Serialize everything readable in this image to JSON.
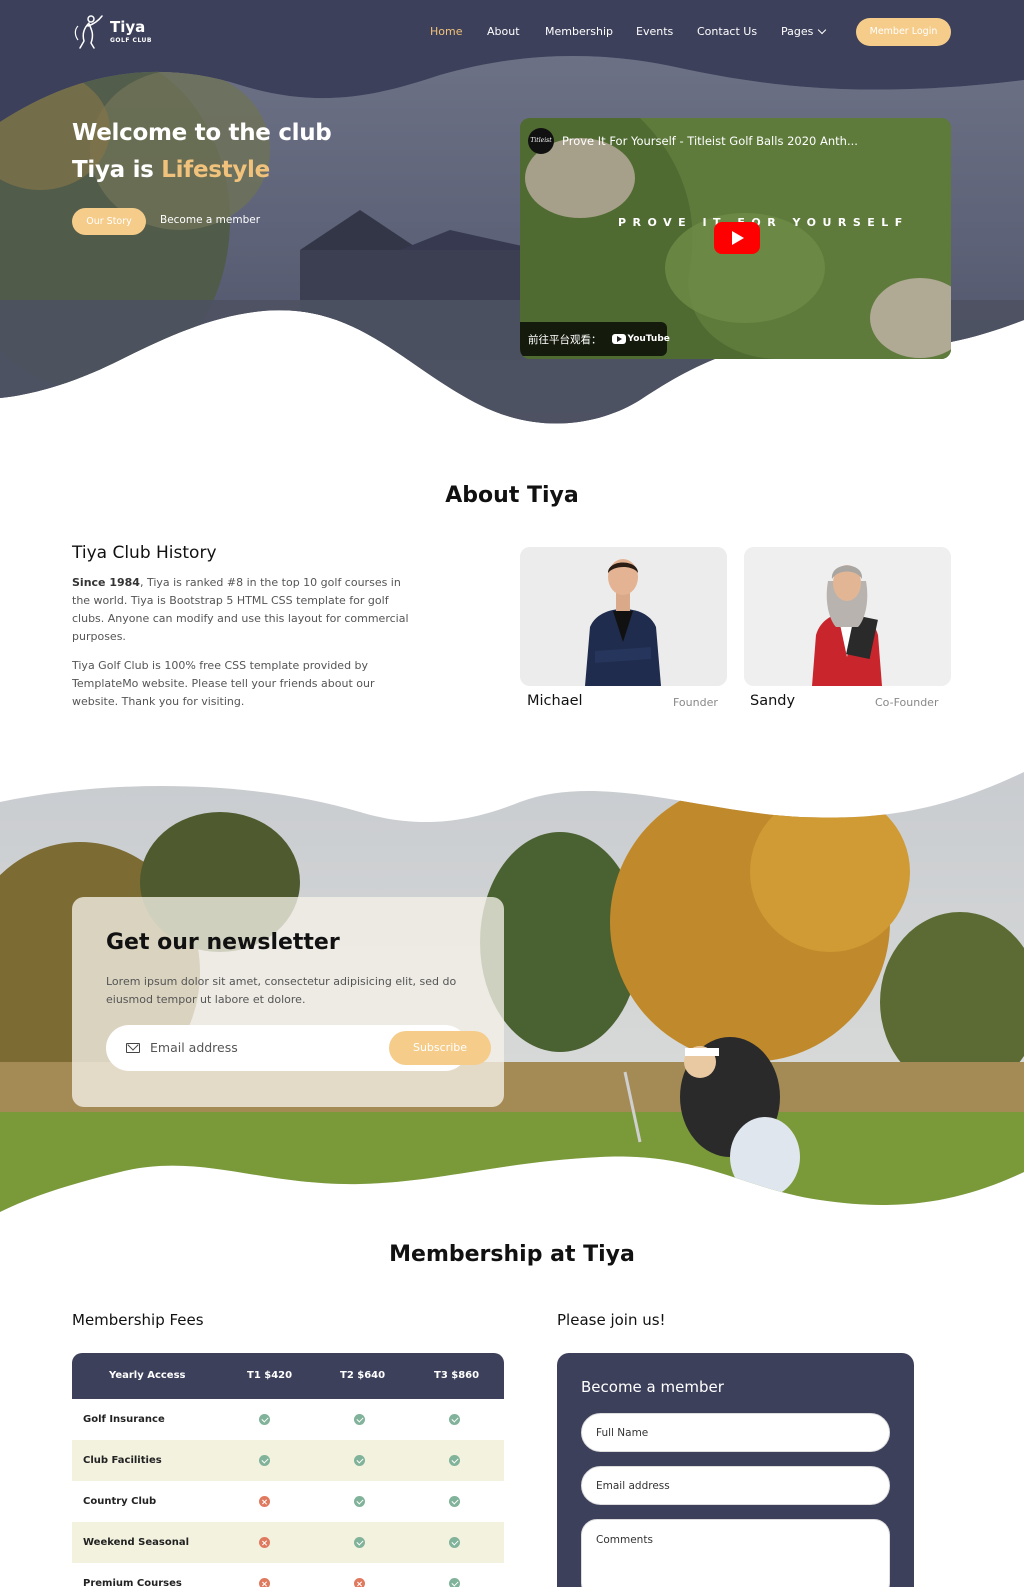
{
  "brand": {
    "name": "Tiya",
    "tagline": "GOLF CLUB"
  },
  "nav": {
    "items": [
      "Home",
      "About",
      "Membership",
      "Events",
      "Contact Us",
      "Pages"
    ],
    "active": "Home",
    "login_label": "Member Login"
  },
  "hero": {
    "line1": "Welcome to the club",
    "line2_prefix": "Tiya is",
    "line2_accent": "Lifestyle",
    "primary_button": "Our Story",
    "secondary_link": "Become a member"
  },
  "video": {
    "channel_logo": "Titleist",
    "title": "Prove It For Yourself - Titleist Golf Balls 2020 Anth...",
    "overlay_text": "PROVE IT FOR YOURSELF",
    "watch_on": "前往平台观看：",
    "platform": "YouTube",
    "icon": "play-icon"
  },
  "about": {
    "title": "About Tiya",
    "history_heading": "Tiya Club History",
    "paragraph1_bold": "Since 1984",
    "paragraph1_rest": ", Tiya is ranked #8 in the top 10 golf courses in the world. Tiya is Bootstrap 5 HTML CSS template for golf clubs. Anyone can modify and use this layout for commercial purposes.",
    "paragraph2": "Tiya Golf Club is 100% free CSS template provided by TemplateMo website. Please tell your friends about our website. Thank you for visiting.",
    "team": [
      {
        "name": "Michael",
        "role": "Founder"
      },
      {
        "name": "Sandy",
        "role": "Co-Founder"
      }
    ]
  },
  "newsletter": {
    "title": "Get our newsletter",
    "description": "Lorem ipsum dolor sit amet, consectetur adipisicing elit, sed do eiusmod tempor ut labore et dolore.",
    "email_placeholder": "Email address",
    "subscribe_label": "Subscribe",
    "icon": "mail-icon"
  },
  "membership": {
    "title": "Membership at Tiya",
    "fees_heading": "Membership Fees",
    "join_heading": "Please join us!",
    "table_headers": [
      "Yearly Access",
      "T1 $420",
      "T2 $640",
      "T3 $860"
    ],
    "rows": [
      {
        "label": "Golf Insurance",
        "t1": true,
        "t2": true,
        "t3": true
      },
      {
        "label": "Club Facilities",
        "t1": true,
        "t2": true,
        "t3": true
      },
      {
        "label": "Country Club",
        "t1": false,
        "t2": true,
        "t3": true
      },
      {
        "label": "Weekend Seasonal",
        "t1": false,
        "t2": true,
        "t3": true
      },
      {
        "label": "Premium Courses",
        "t1": false,
        "t2": false,
        "t3": true
      }
    ],
    "form": {
      "title": "Become a member",
      "name_placeholder": "Full Name",
      "email_placeholder": "Email address",
      "comments_placeholder": "Comments"
    }
  },
  "colors": {
    "navy": "#3d405b",
    "accent": "#f0c27b",
    "button": "#f5cc8a",
    "check": "#81b29a",
    "cross": "#e07a5f",
    "row_alt": "#f3f2df"
  }
}
